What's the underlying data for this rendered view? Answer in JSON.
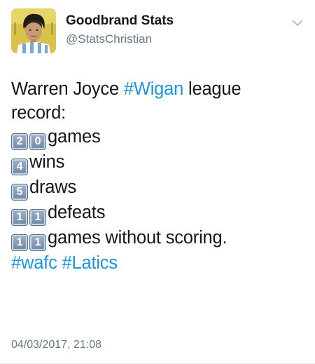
{
  "tweet": {
    "author": {
      "display_name": "Goodbrand Stats",
      "handle": "@StatsChristian",
      "avatar_icon": "profile-photo-icon"
    },
    "menu_icon": "chevron-down-icon",
    "lines": {
      "l1_text": "Warren Joyce ",
      "l1_hashtag": "#Wigan",
      "l1_tail": " league",
      "l2_text": "record:",
      "l3_digits": [
        "2",
        "0"
      ],
      "l3_text": "games",
      "l4_digits": [
        "4"
      ],
      "l4_text": "wins",
      "l5_digits": [
        "5"
      ],
      "l5_text": "draws",
      "l6_digits": [
        "1",
        "1"
      ],
      "l6_text": "defeats",
      "l7_digits": [
        "1",
        "1"
      ],
      "l7_text": "games without scoring.",
      "l8_hashtag1": "#wafc",
      "l8_hashtag2": "#Latics"
    },
    "timestamp": "04/03/2017, 21:08"
  },
  "colors": {
    "link": "#1b95e0",
    "secondary_text": "#657786",
    "primary_text": "#14171a"
  }
}
